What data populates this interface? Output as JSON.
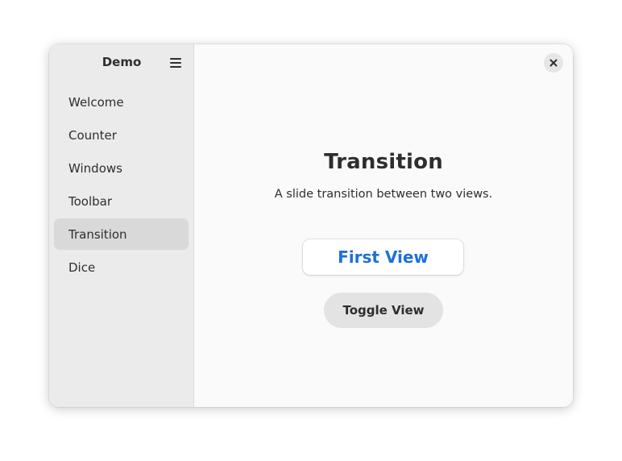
{
  "sidebar": {
    "title": "Demo",
    "menu_icon": "hamburger-menu-icon",
    "items": [
      {
        "label": "Welcome",
        "selected": false
      },
      {
        "label": "Counter",
        "selected": false
      },
      {
        "label": "Windows",
        "selected": false
      },
      {
        "label": "Toolbar",
        "selected": false
      },
      {
        "label": "Transition",
        "selected": true
      },
      {
        "label": "Dice",
        "selected": false
      }
    ]
  },
  "header": {
    "close_icon": "close-icon"
  },
  "main": {
    "title": "Transition",
    "subtitle": "A slide transition between two views.",
    "current_view_label": "First View",
    "toggle_button_label": "Toggle View"
  },
  "colors": {
    "accent": "#1c71d8",
    "sidebar_bg": "#ebebeb",
    "selected_item_bg": "#d9d9d9",
    "content_bg": "#fafafa",
    "button_bg": "#e3e3e3"
  }
}
